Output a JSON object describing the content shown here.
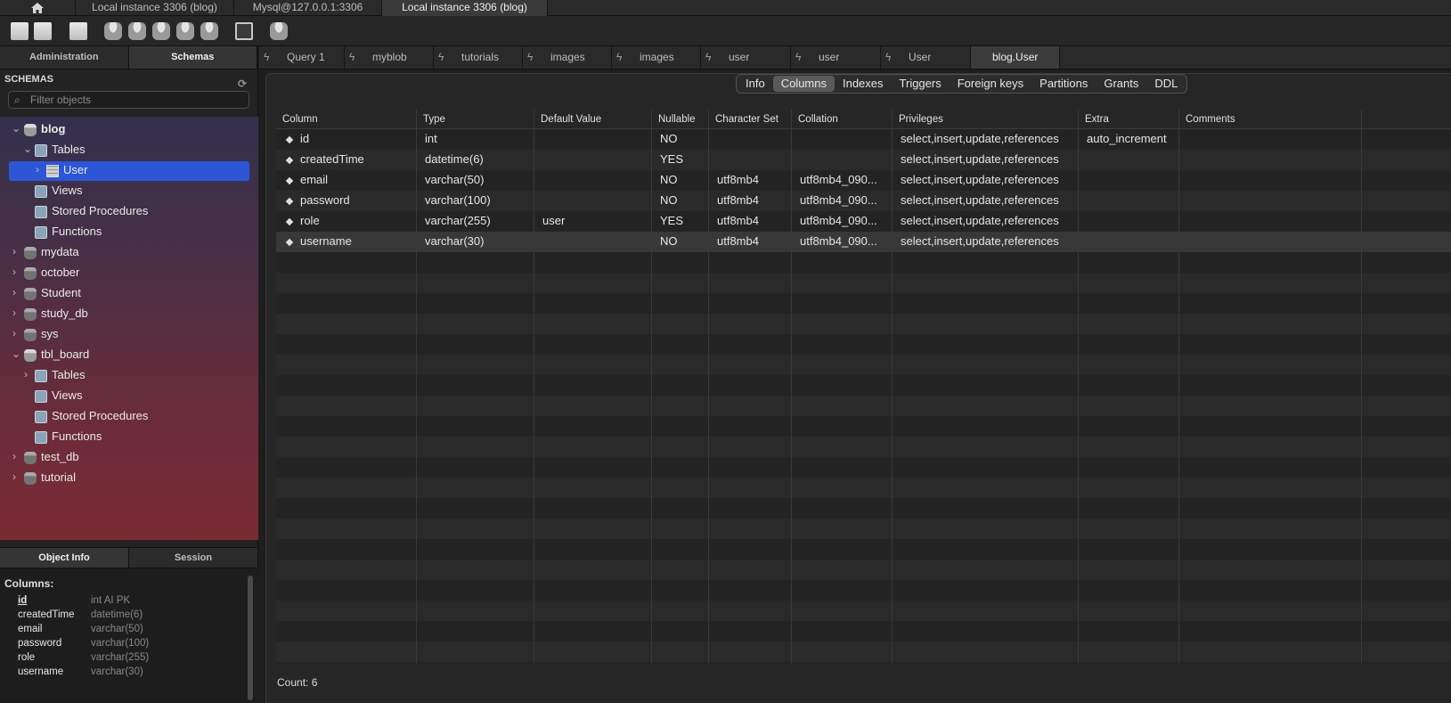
{
  "connection_tabs": [
    {
      "label": "Local instance 3306 (blog)",
      "active": false
    },
    {
      "label": "Mysql@127.0.0.1:3306",
      "active": false
    },
    {
      "label": "Local instance 3306 (blog)",
      "active": true
    }
  ],
  "sidebar": {
    "tabs": [
      "Administration",
      "Schemas"
    ],
    "active_tab": "Schemas",
    "section_title": "SCHEMAS",
    "filter_placeholder": "Filter objects",
    "tree": [
      {
        "label": "blog",
        "kind": "db",
        "expanded": true
      },
      {
        "label": "Tables",
        "kind": "folder",
        "expanded": true
      },
      {
        "label": "User",
        "kind": "table",
        "selected": true
      },
      {
        "label": "Views",
        "kind": "folder"
      },
      {
        "label": "Stored Procedures",
        "kind": "folder"
      },
      {
        "label": "Functions",
        "kind": "folder"
      },
      {
        "label": "mydata",
        "kind": "db"
      },
      {
        "label": "october",
        "kind": "db"
      },
      {
        "label": "Student",
        "kind": "db"
      },
      {
        "label": "study_db",
        "kind": "db"
      },
      {
        "label": "sys",
        "kind": "db"
      },
      {
        "label": "tbl_board",
        "kind": "db",
        "expanded": true
      },
      {
        "label": "Tables",
        "kind": "folder"
      },
      {
        "label": "Views",
        "kind": "folder"
      },
      {
        "label": "Stored Procedures",
        "kind": "folder"
      },
      {
        "label": "Functions",
        "kind": "folder"
      },
      {
        "label": "test_db",
        "kind": "db"
      },
      {
        "label": "tutorial",
        "kind": "db"
      }
    ],
    "info_tabs": [
      "Object Info",
      "Session"
    ],
    "active_info_tab": "Object Info",
    "object_info": {
      "title": "Columns:",
      "columns": [
        {
          "name": "id",
          "type": "int AI PK",
          "pk": true
        },
        {
          "name": "createdTime",
          "type": "datetime(6)"
        },
        {
          "name": "email",
          "type": "varchar(50)"
        },
        {
          "name": "password",
          "type": "varchar(100)"
        },
        {
          "name": "role",
          "type": "varchar(255)"
        },
        {
          "name": "username",
          "type": "varchar(30)"
        }
      ]
    }
  },
  "query_tabs": [
    {
      "label": "Query 1"
    },
    {
      "label": "myblob"
    },
    {
      "label": "tutorials"
    },
    {
      "label": "images"
    },
    {
      "label": "images"
    },
    {
      "label": "user"
    },
    {
      "label": "user"
    },
    {
      "label": "User"
    },
    {
      "label": "blog.User",
      "active": true
    }
  ],
  "inspector_tabs": [
    "Info",
    "Columns",
    "Indexes",
    "Triggers",
    "Foreign keys",
    "Partitions",
    "Grants",
    "DDL"
  ],
  "active_inspector_tab": "Columns",
  "grid": {
    "headers": [
      "Column",
      "Type",
      "Default Value",
      "Nullable",
      "Character Set",
      "Collation",
      "Privileges",
      "Extra",
      "Comments"
    ],
    "rows": [
      [
        "id",
        "int",
        "",
        "NO",
        "",
        "",
        "select,insert,update,references",
        "auto_increment",
        ""
      ],
      [
        "createdTime",
        "datetime(6)",
        "",
        "YES",
        "",
        "",
        "select,insert,update,references",
        "",
        ""
      ],
      [
        "email",
        "varchar(50)",
        "",
        "NO",
        "utf8mb4",
        "utf8mb4_090...",
        "select,insert,update,references",
        "",
        ""
      ],
      [
        "password",
        "varchar(100)",
        "",
        "NO",
        "utf8mb4",
        "utf8mb4_090...",
        "select,insert,update,references",
        "",
        ""
      ],
      [
        "role",
        "varchar(255)",
        "user",
        "YES",
        "utf8mb4",
        "utf8mb4_090...",
        "select,insert,update,references",
        "",
        ""
      ],
      [
        "username",
        "varchar(30)",
        "",
        "NO",
        "utf8mb4",
        "utf8mb4_090...",
        "select,insert,update,references",
        "",
        ""
      ]
    ],
    "selected_row": 5
  },
  "count_label": "Count: 6"
}
